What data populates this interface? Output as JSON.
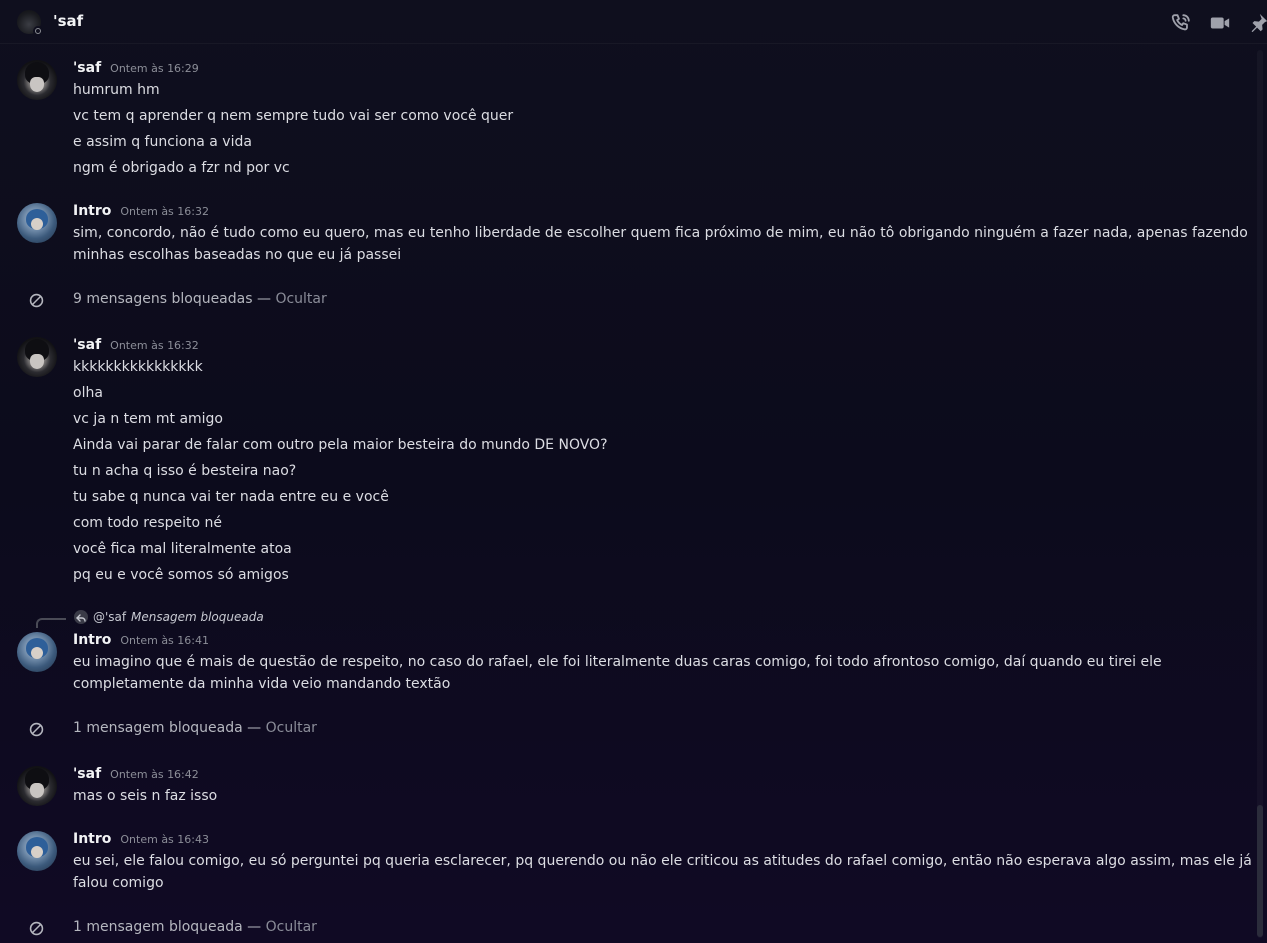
{
  "header": {
    "title": "'saf",
    "icons": [
      "phone-call-icon",
      "video-camera-icon",
      "pin-icon"
    ]
  },
  "messages": [
    {
      "author": "'saf",
      "timestamp": "Ontem às 16:29",
      "lines": [
        "humrum hm",
        "vc tem q aprender q nem sempre tudo vai ser como você quer",
        "e assim q funciona a vida",
        "ngm é obrigado a fzr nd por vc"
      ]
    },
    {
      "author": "Intro",
      "timestamp": "Ontem às 16:32",
      "lines": [
        "sim, concordo, não é tudo como eu quero, mas eu tenho liberdade de escolher quem fica próximo de mim, eu não tô obrigando ninguém a fazer nada, apenas fazendo",
        "minhas escolhas baseadas no que eu já passei"
      ]
    },
    {
      "author": "'saf",
      "timestamp": "Ontem às 16:32",
      "lines": [
        "kkkkkkkkkkkkkkkk",
        "olha",
        "vc ja n tem mt amigo",
        "Ainda vai parar de falar com outro pela maior besteira do mundo DE NOVO?",
        "tu n acha q isso é besteira nao?",
        "tu sabe q nunca vai ter nada entre eu e você",
        "com todo respeito né",
        "você fica mal literalmente atoa",
        "pq eu e você somos só amigos"
      ]
    },
    {
      "author": "Intro",
      "timestamp": "Ontem às 16:41",
      "reply": {
        "user": "@'saf",
        "text": "Mensagem bloqueada"
      },
      "lines": [
        "eu imagino que é mais de questão de respeito, no caso do rafael, ele foi literalmente duas caras comigo, foi todo afrontoso comigo, daí quando eu tirei ele",
        "completamente da minha vida veio mandando textão"
      ]
    },
    {
      "author": "'saf",
      "timestamp": "Ontem às 16:42",
      "lines": [
        "mas o seis n faz isso"
      ]
    },
    {
      "author": "Intro",
      "timestamp": "Ontem às 16:43",
      "lines": [
        "eu sei, ele falou comigo, eu só perguntei pq queria esclarecer, pq querendo ou não ele criticou as atitudes do rafael comigo, então não esperava algo assim, mas ele já",
        "falou comigo"
      ]
    }
  ],
  "blocked": [
    {
      "count_text": "9 mensagens bloqueadas",
      "separator": "—",
      "toggle": "Ocultar"
    },
    {
      "count_text": "1 mensagem bloqueada",
      "separator": "—",
      "toggle": "Ocultar"
    },
    {
      "count_text": "1 mensagem bloqueada",
      "separator": "—",
      "toggle": "Ocultar"
    }
  ]
}
